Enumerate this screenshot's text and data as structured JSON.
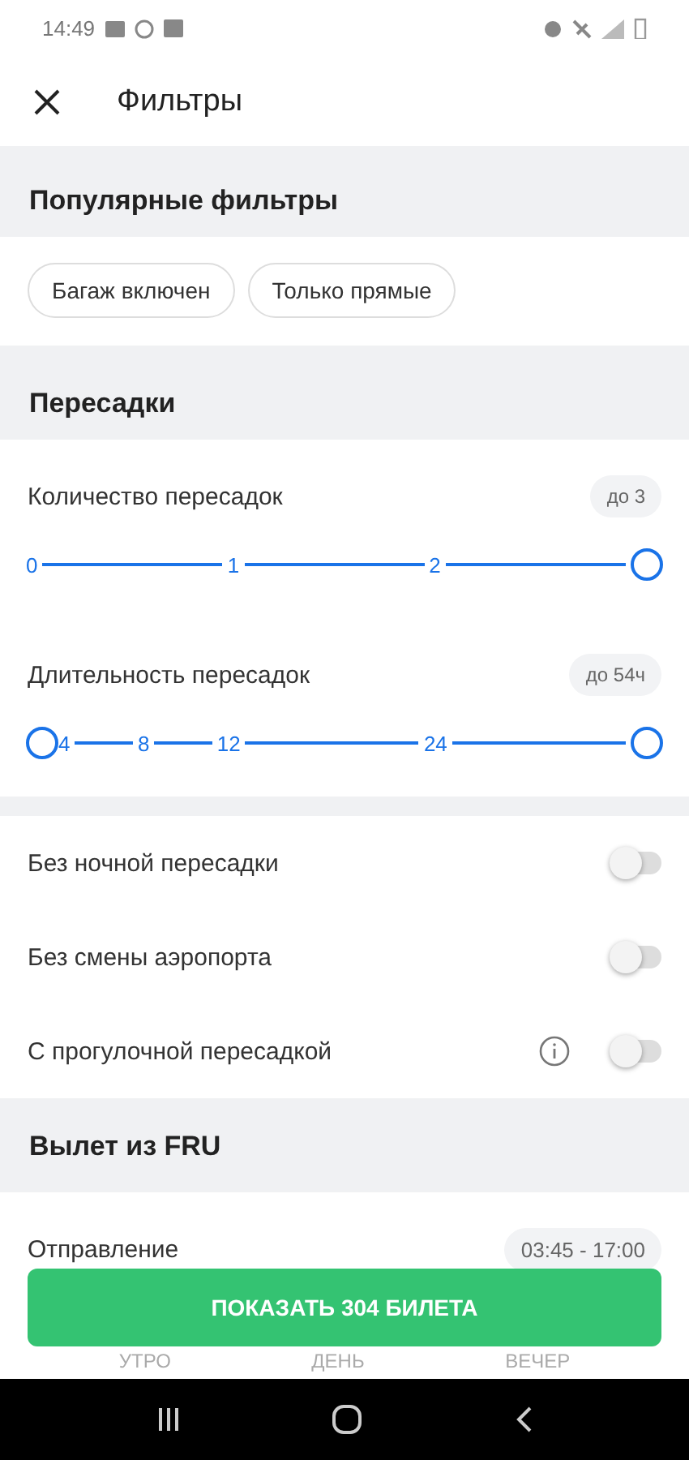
{
  "status_bar": {
    "time": "14:49"
  },
  "header": {
    "title": "Фильтры"
  },
  "sections": [
    {
      "kind": "chips",
      "title": "Популярные фильтры",
      "chips": [
        {
          "label": "Багаж включен",
          "selected": false
        },
        {
          "label": "Только прямые",
          "selected": false
        }
      ]
    },
    {
      "kind": "sliders",
      "title": "Пересадки",
      "sliders": [
        {
          "label": "Количество пересадок",
          "value": "до 3",
          "ticks": [
            "0",
            "1",
            "2"
          ],
          "thumbs": [
            {
              "level": 1
            }
          ]
        },
        {
          "label": "Длительность пересадок",
          "value": "до 54ч",
          "ticks": [
            "4",
            "8",
            "12",
            "24"
          ],
          "thumbs": [
            {
              "level": 0
            },
            {
              "level": 1
            }
          ]
        }
      ]
    },
    {
      "kind": "toggles",
      "toggles": [
        {
          "label": "Без ночной пересадки",
          "on": false,
          "info": false
        },
        {
          "label": "Без смены аэропорта",
          "on": false,
          "info": false
        },
        {
          "label": "С прогулочной пересадкой",
          "on": false,
          "info": true
        }
      ]
    },
    {
      "kind": "times",
      "title": "Вылет из FRU",
      "label": "Отправление",
      "value": "03:45 - 17:00",
      "periods": [
        "УТРО",
        "ДЕНЬ",
        "ВЕЧЕР"
      ]
    }
  ],
  "action_button": {
    "label": "ПОКАЗАТЬ 304 БИЛЕТА"
  }
}
